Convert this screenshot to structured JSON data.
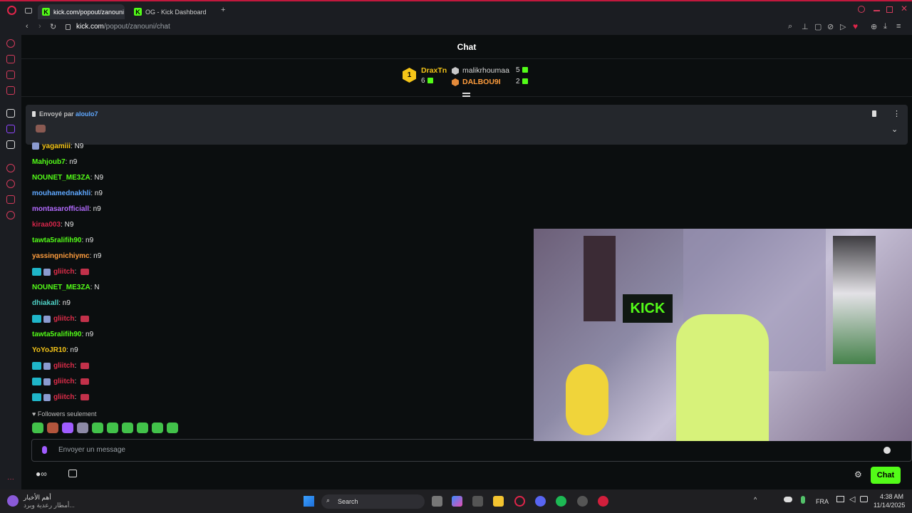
{
  "browser": {
    "tabs": [
      {
        "label": "kick.com/popout/zanouni",
        "active": true
      },
      {
        "label": "OG - Kick Dashboard",
        "active": false
      }
    ],
    "new_tab": "+",
    "url_host": "kick.com",
    "url_path": "/popout/zanouni/chat"
  },
  "chat": {
    "title": "Chat",
    "leaderboard": {
      "rank": "1",
      "first": {
        "name": "DraxTn",
        "count": "6"
      },
      "second": {
        "name": "malikrhoumaa",
        "count": "5"
      },
      "third": {
        "name": "DALBOU9I",
        "count": "2"
      }
    },
    "pinned": {
      "prefix": "Envoyé par",
      "user": "aloulo7"
    },
    "messages": [
      {
        "user": "yagamiii",
        "text": ": N9",
        "color": "#f5c518"
      },
      {
        "user": "Mahjoub7",
        "text": ": n9",
        "color": "#53fc18"
      },
      {
        "user": "NOUNET_ME3ZA",
        "text": ": N9",
        "color": "#53fc18"
      },
      {
        "user": "mouhamednakhli",
        "text": ": n9",
        "color": "#5fa8ff"
      },
      {
        "user": "montasarofficiall",
        "text": ": n9",
        "color": "#b36bff"
      },
      {
        "user": "kiraa003",
        "text": ": N9",
        "color": "#d4264a"
      },
      {
        "user": "tawta5ralifih90",
        "text": ": n9",
        "color": "#53fc18"
      },
      {
        "user": "yassingnichiymc",
        "text": ": n9",
        "color": "#ff9d3d"
      },
      {
        "user": "gliitch",
        "text": ":",
        "color": "#e02d4a"
      },
      {
        "user": "NOUNET_ME3ZA",
        "text": ": N",
        "color": "#53fc18"
      },
      {
        "user": "dhiakall",
        "text": ": n9",
        "color": "#4fd1c5"
      },
      {
        "user": "gliitch",
        "text": ":",
        "color": "#e02d4a"
      },
      {
        "user": "tawta5ralifih90",
        "text": ": n9",
        "color": "#53fc18"
      },
      {
        "user": "YoYoJR10",
        "text": ": n9",
        "color": "#f5c518"
      },
      {
        "user": "gliitch",
        "text": ":",
        "color": "#e02d4a"
      },
      {
        "user": "gliitch",
        "text": ":",
        "color": "#e02d4a"
      },
      {
        "user": "gliitch",
        "text": ":",
        "color": "#e02d4a"
      }
    ],
    "followers_only": "Followers seulement",
    "input_placeholder": "Envoyer un message",
    "send_button": "Chat"
  },
  "taskbar": {
    "news_title": "أهم الأخبار",
    "news_sub": "أمطار رعدية وبرد...",
    "search_label": "Search",
    "lang": "FRA",
    "time": "4:38 AM",
    "date": "11/14/2025"
  },
  "colors": {
    "kick_green": "#53fc18",
    "opera_red": "#d33b5b"
  }
}
